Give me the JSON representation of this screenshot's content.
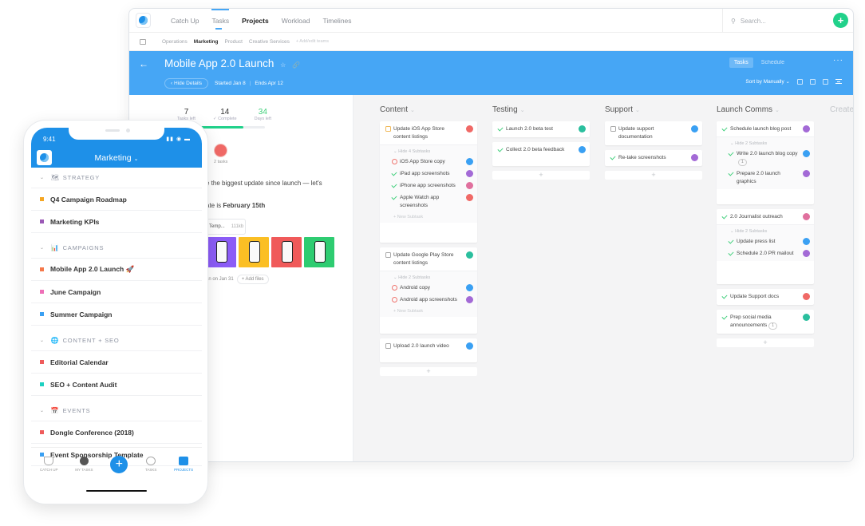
{
  "app": {
    "nav": [
      "Catch Up",
      "Tasks",
      "Projects",
      "Workload",
      "Timelines"
    ],
    "active_nav": "Projects",
    "search_placeholder": "Search...",
    "teams": [
      "Operations",
      "Marketing",
      "Product",
      "Creative Services"
    ],
    "active_team": "Marketing",
    "add_teams": "+ Add/edit teams"
  },
  "project": {
    "title": "Mobile App 2.0 Launch",
    "hide_details": "Hide Details",
    "started": "Started Jan 8",
    "ends": "Ends Apr 12",
    "view_tabs": [
      "Tasks",
      "Schedule"
    ],
    "active_view": "Tasks",
    "sort": "Sort by Manually",
    "stats": [
      {
        "value": "7",
        "label": "Tasks left"
      },
      {
        "value": "14",
        "label": "✓ Complete"
      },
      {
        "value": "34",
        "label": "Days left"
      }
    ],
    "progress": 0.66,
    "assignee_label": "2 tasks",
    "description_1": "e the biggest update since launch — let's",
    "description_2_prefix": "ate is ",
    "description_2_bold": "February 15th",
    "file_name": "Temp...",
    "file_size": "111kb",
    "thumb_colors": [
      "#8b5cf6",
      "#fbbf24",
      "#f05a5a",
      "#2ecc71"
    ],
    "footer_text": "an on Jan 31",
    "add_files": "+ Add files"
  },
  "board": {
    "create_label": "Create",
    "columns": [
      {
        "name": "Content",
        "cards": [
          {
            "title": "Update iOS App Store content listings",
            "status": "in-progress",
            "subtasks_label": "Hide 4 Subtasks",
            "subtasks": [
              {
                "title": "iOS App Store copy",
                "status": "open"
              },
              {
                "title": "iPad app screenshots",
                "status": "done"
              },
              {
                "title": "iPhone app screenshots",
                "status": "done"
              },
              {
                "title": "Apple Watch app screenshots",
                "status": "done"
              }
            ],
            "new_subtask": "+ New Subtask"
          },
          {
            "title": "Update Google Play Store content listings",
            "status": "todo",
            "subtasks_label": "Hide 2 Subtasks",
            "subtasks": [
              {
                "title": "Android copy",
                "status": "open"
              },
              {
                "title": "Android app screenshots",
                "status": "open"
              }
            ],
            "new_subtask": "+ New Subtask"
          },
          {
            "title": "Upload 2.0 launch video",
            "status": "todo"
          }
        ]
      },
      {
        "name": "Testing",
        "cards": [
          {
            "title": "Launch 2.0 beta test",
            "status": "done"
          },
          {
            "title": "Collect 2.0 beta feedback",
            "status": "done"
          }
        ]
      },
      {
        "name": "Support",
        "cards": [
          {
            "title": "Update support documentation",
            "status": "todo"
          },
          {
            "title": "Re-take screenshots",
            "status": "done"
          }
        ]
      },
      {
        "name": "Launch Comms",
        "cards": [
          {
            "title": "Schedule launch blog post",
            "status": "done",
            "subtasks_label": "Hide 2 Subtasks",
            "subtasks": [
              {
                "title": "Write 2.0 launch blog copy",
                "status": "done",
                "comments": "1"
              },
              {
                "title": "Prepare 2.0 launch graphics",
                "status": "done"
              }
            ]
          },
          {
            "title": "2.0 Journalist outreach",
            "status": "done",
            "subtasks_label": "Hide 2 Subtasks",
            "subtasks": [
              {
                "title": "Update press list",
                "status": "done"
              },
              {
                "title": "Schedule 2.0 PR mailout",
                "status": "done"
              }
            ]
          },
          {
            "title": "Update Support docs",
            "status": "done"
          },
          {
            "title": "Prep social media announcements",
            "status": "done",
            "comments": "1"
          }
        ]
      }
    ]
  },
  "mobile": {
    "time": "9:41",
    "status_icons": "signal wifi battery",
    "team": "Marketing",
    "sections": [
      {
        "name": "STRATEGY",
        "emoji": "🗺",
        "items": [
          {
            "name": "Q4 Campaign Roadmap",
            "color": "#f5a623"
          },
          {
            "name": "Marketing KPIs",
            "color": "#9b59b6"
          }
        ]
      },
      {
        "name": "CAMPAIGNS",
        "emoji": "📊",
        "items": [
          {
            "name": "Mobile App 2.0 Launch 🚀",
            "color": "#f5784a"
          },
          {
            "name": "June Campaign",
            "color": "#ee6fb7"
          },
          {
            "name": "Summer Campaign",
            "color": "#3aa0f3"
          }
        ]
      },
      {
        "name": "CONTENT + SEO",
        "emoji": "🌐",
        "items": [
          {
            "name": "Editorial Calendar",
            "color": "#ef5b5b"
          },
          {
            "name": "SEO + Content Audit",
            "color": "#1dd1c1"
          }
        ]
      },
      {
        "name": "EVENTS",
        "emoji": "📅",
        "items": [
          {
            "name": "Dongle Conference (2018)",
            "color": "#ef5b5b"
          },
          {
            "name": "Event Sponsorship Template",
            "color": "#3aa0f3"
          }
        ]
      }
    ],
    "tabs": [
      "CATCH UP",
      "MY TASKS",
      "TASKS",
      "PROJECTS"
    ],
    "active_tab": "PROJECTS"
  },
  "colors": {
    "accent": "#46a6f5",
    "mobile_accent": "#1e90e8",
    "success": "#21d18a"
  }
}
